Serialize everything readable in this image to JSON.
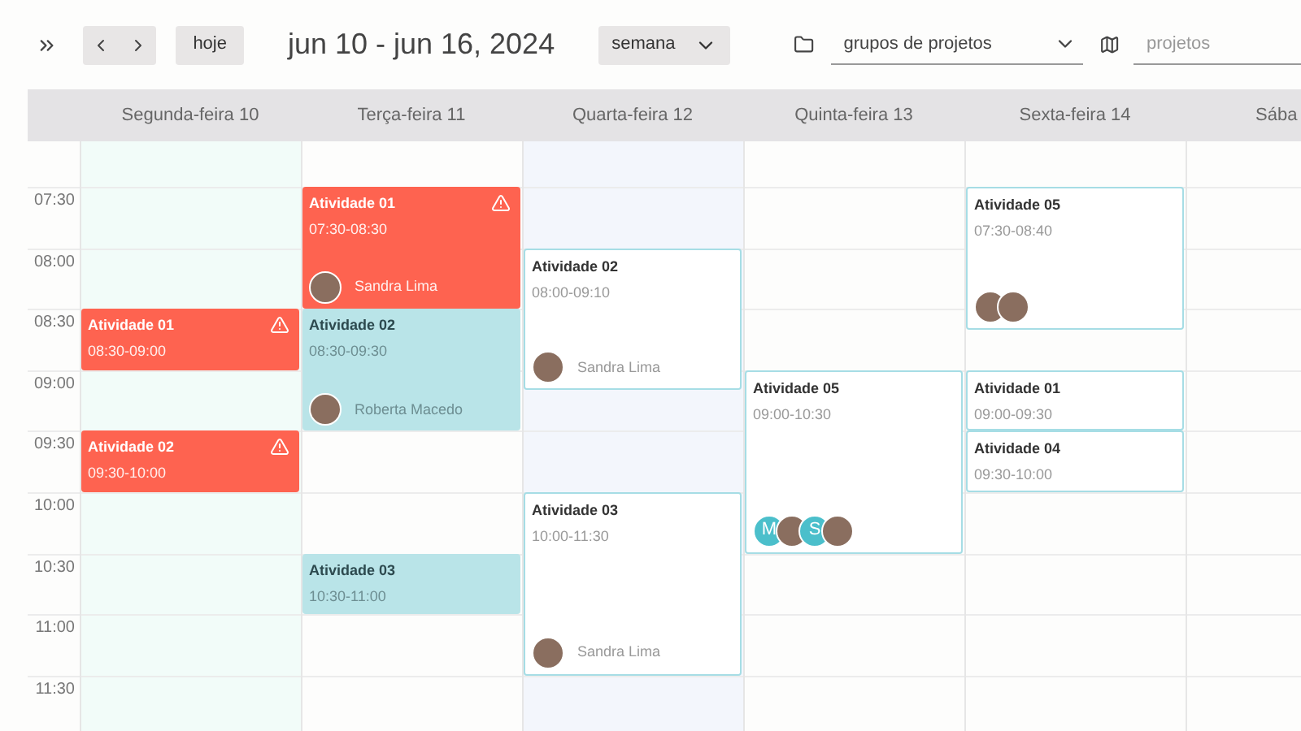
{
  "toolbar": {
    "title": "jun 10 - jun 16, 2024",
    "today_button": "hoje",
    "view_select": "semana",
    "group_select": "grupos de projetos",
    "project_search": {
      "placeholder": "projetos"
    }
  },
  "times": [
    "07:30",
    "08:00",
    "08:30",
    "09:00",
    "09:30",
    "10:00",
    "10:30",
    "11:00",
    "11:30"
  ],
  "days": [
    {
      "label": "Segunda-feira 10",
      "color": "#f2fcf9",
      "events": [
        {
          "kind": "alert",
          "title": "Atividade 01",
          "time": "08:30-09:00"
        },
        {
          "kind": "alert",
          "title": "Atividade 02",
          "time": "09:30-10:00"
        }
      ]
    },
    {
      "label": "Terça-feira 11",
      "color": "#fdfdfc",
      "events": [
        {
          "kind": "alert",
          "title": "Atividade 01",
          "time": "07:30-08:30",
          "people": [
            {
              "kind": "photo",
              "name": "Sandra Lima"
            }
          ]
        },
        {
          "kind": "highlight",
          "title": "Atividade 02",
          "time": "08:30-09:30",
          "people": [
            {
              "kind": "photo",
              "name": "Roberta Macedo"
            }
          ]
        },
        {
          "kind": "highlight",
          "title": "Atividade 03",
          "time": "10:30-11:00"
        }
      ]
    },
    {
      "label": "Quarta-feira 12",
      "color": "#f3f6fc",
      "events": [
        {
          "kind": "outline",
          "title": "Atividade 02",
          "time": "08:00-09:10",
          "people": [
            {
              "kind": "photo",
              "name": "Sandra Lima"
            }
          ]
        },
        {
          "kind": "outline",
          "title": "Atividade 03",
          "time": "10:00-11:30",
          "people": [
            {
              "kind": "photo",
              "name": "Sandra Lima"
            }
          ]
        }
      ]
    },
    {
      "label": "Quinta-feira 13",
      "color": "#fdfdfc",
      "events": [
        {
          "kind": "outline",
          "title": "Atividade 05",
          "time": "09:00-10:30",
          "people": [
            {
              "kind": "initial",
              "initial": "M"
            },
            {
              "kind": "photo"
            },
            {
              "kind": "initial",
              "initial": "S"
            },
            {
              "kind": "photo"
            }
          ]
        }
      ]
    },
    {
      "label": "Sexta-feira 14",
      "color": "#fdfdfc",
      "events": [
        {
          "kind": "outline",
          "title": "Atividade 05",
          "time": "07:30-08:40",
          "people": [
            {
              "kind": "photo"
            },
            {
              "kind": "photo"
            }
          ]
        },
        {
          "kind": "outline",
          "title": "Atividade 01",
          "time": "09:00-09:30"
        },
        {
          "kind": "outline",
          "title": "Atividade 04",
          "time": "09:30-10:00"
        }
      ]
    },
    {
      "label": "Sába",
      "color": "#fdfdfc"
    }
  ]
}
